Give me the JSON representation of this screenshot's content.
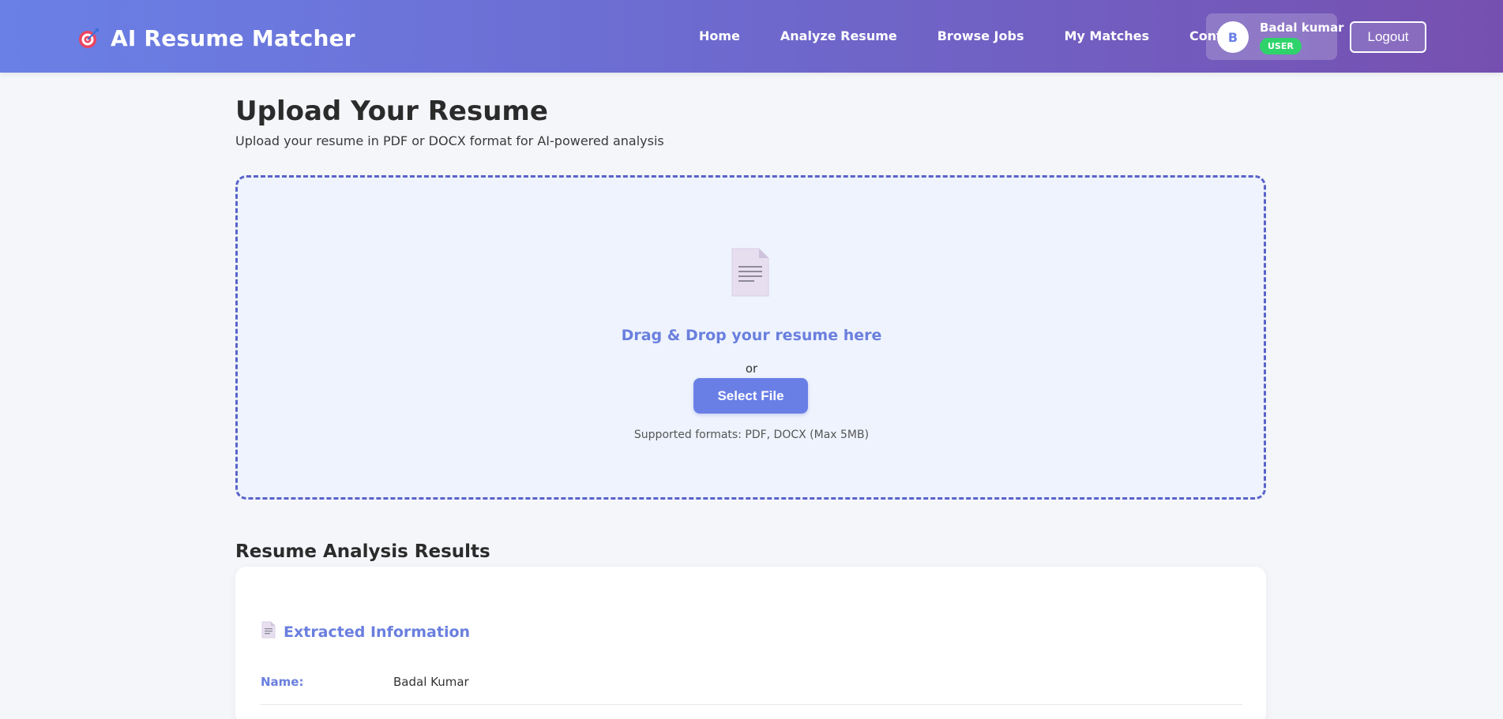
{
  "app": {
    "title": "AI Resume Matcher",
    "logo_icon": "target-icon"
  },
  "nav": {
    "items": [
      {
        "label": "Home"
      },
      {
        "label": "Analyze Resume"
      },
      {
        "label": "Browse Jobs"
      },
      {
        "label": "My Matches"
      },
      {
        "label": "Contact"
      }
    ]
  },
  "user": {
    "initial": "B",
    "name": "Badal kumar",
    "role": "USER",
    "logout_label": "Logout"
  },
  "upload": {
    "title": "Upload Your Resume",
    "subtitle": "Upload your resume in PDF or DOCX format for AI-powered analysis",
    "icon": "document-icon",
    "drop_text": "Drag & Drop your resume here",
    "or_text": "or",
    "select_label": "Select File",
    "formats_text": "Supported formats: PDF, DOCX (Max 5MB)"
  },
  "results": {
    "title": "Resume Analysis Results",
    "extracted_heading": "Extracted Information",
    "fields": [
      {
        "label": "Name:",
        "value": "Badal Kumar"
      }
    ]
  },
  "colors": {
    "header_start": "#6a80e6",
    "header_end": "#7650b0",
    "accent": "#6a7fde",
    "role_badge": "#2fd36b",
    "dropzone_border": "#5a63c9"
  }
}
